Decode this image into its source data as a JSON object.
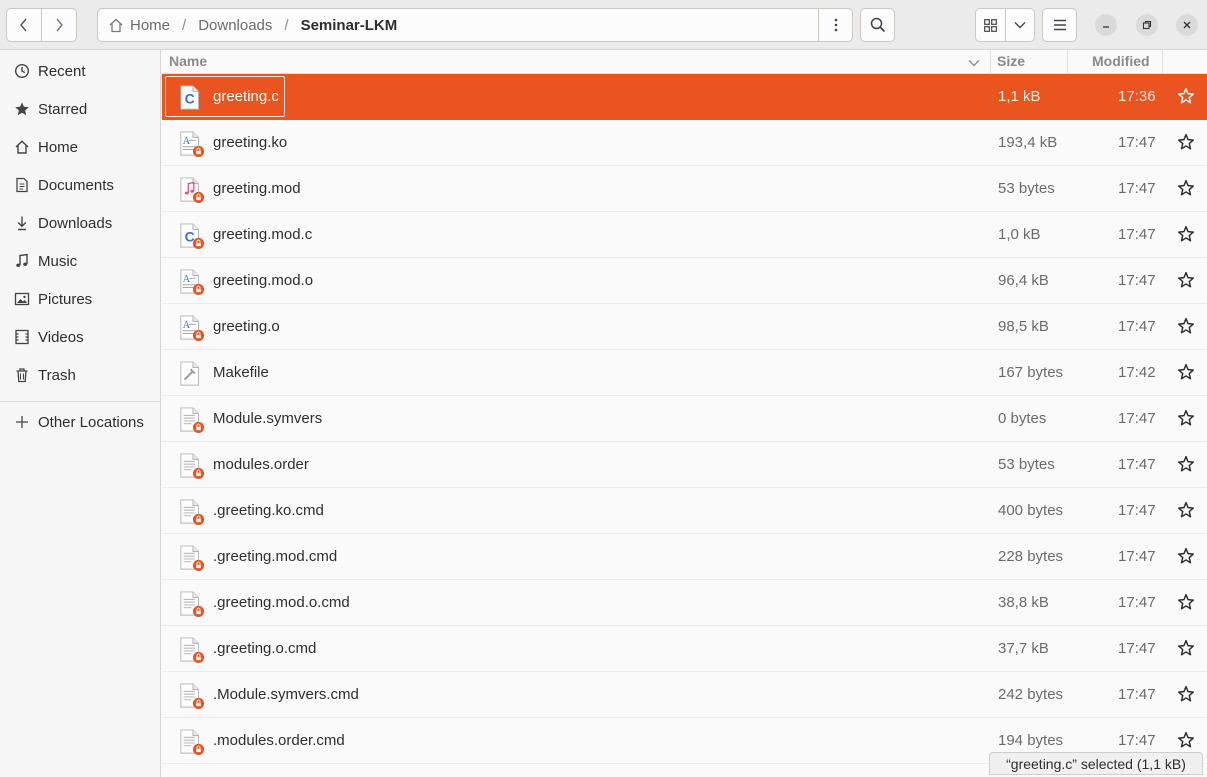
{
  "path": {
    "crumbs": [
      "Home",
      "Downloads",
      "Seminar-LKM"
    ]
  },
  "sidebar": {
    "items": [
      {
        "label": "Recent",
        "icon": "clock-icon"
      },
      {
        "label": "Starred",
        "icon": "star-icon"
      },
      {
        "label": "Home",
        "icon": "home-icon"
      },
      {
        "label": "Documents",
        "icon": "document-icon"
      },
      {
        "label": "Downloads",
        "icon": "download-icon"
      },
      {
        "label": "Music",
        "icon": "music-icon"
      },
      {
        "label": "Pictures",
        "icon": "picture-icon"
      },
      {
        "label": "Videos",
        "icon": "video-icon"
      },
      {
        "label": "Trash",
        "icon": "trash-icon"
      }
    ],
    "other_locations": "Other Locations"
  },
  "columns": {
    "name": "Name",
    "size": "Size",
    "modified": "Modified"
  },
  "files": [
    {
      "name": "greeting.c",
      "size": "1,1 kB",
      "modified": "17:36",
      "type": "c-source",
      "locked": false,
      "selected": true
    },
    {
      "name": "greeting.ko",
      "size": "193,4 kB",
      "modified": "17:47",
      "type": "binary",
      "locked": true
    },
    {
      "name": "greeting.mod",
      "size": "53 bytes",
      "modified": "17:47",
      "type": "audio",
      "locked": true
    },
    {
      "name": "greeting.mod.c",
      "size": "1,0 kB",
      "modified": "17:47",
      "type": "c-source",
      "locked": true
    },
    {
      "name": "greeting.mod.o",
      "size": "96,4 kB",
      "modified": "17:47",
      "type": "binary",
      "locked": true
    },
    {
      "name": "greeting.o",
      "size": "98,5 kB",
      "modified": "17:47",
      "type": "binary",
      "locked": true
    },
    {
      "name": "Makefile",
      "size": "167 bytes",
      "modified": "17:42",
      "type": "makefile",
      "locked": false
    },
    {
      "name": "Module.symvers",
      "size": "0 bytes",
      "modified": "17:47",
      "type": "text",
      "locked": true
    },
    {
      "name": "modules.order",
      "size": "53 bytes",
      "modified": "17:47",
      "type": "text",
      "locked": true
    },
    {
      "name": ".greeting.ko.cmd",
      "size": "400 bytes",
      "modified": "17:47",
      "type": "text",
      "locked": true
    },
    {
      "name": ".greeting.mod.cmd",
      "size": "228 bytes",
      "modified": "17:47",
      "type": "text",
      "locked": true
    },
    {
      "name": ".greeting.mod.o.cmd",
      "size": "38,8 kB",
      "modified": "17:47",
      "type": "text",
      "locked": true
    },
    {
      "name": ".greeting.o.cmd",
      "size": "37,7 kB",
      "modified": "17:47",
      "type": "text",
      "locked": true
    },
    {
      "name": ".Module.symvers.cmd",
      "size": "242 bytes",
      "modified": "17:47",
      "type": "text",
      "locked": true
    },
    {
      "name": ".modules.order.cmd",
      "size": "194 bytes",
      "modified": "17:47",
      "type": "text",
      "locked": true
    }
  ],
  "status": "“greeting.c” selected  (1,1 kB)",
  "colors": {
    "accent": "#e95420",
    "c_blue": "#3f6fd8",
    "lock_orange": "#e95420"
  }
}
